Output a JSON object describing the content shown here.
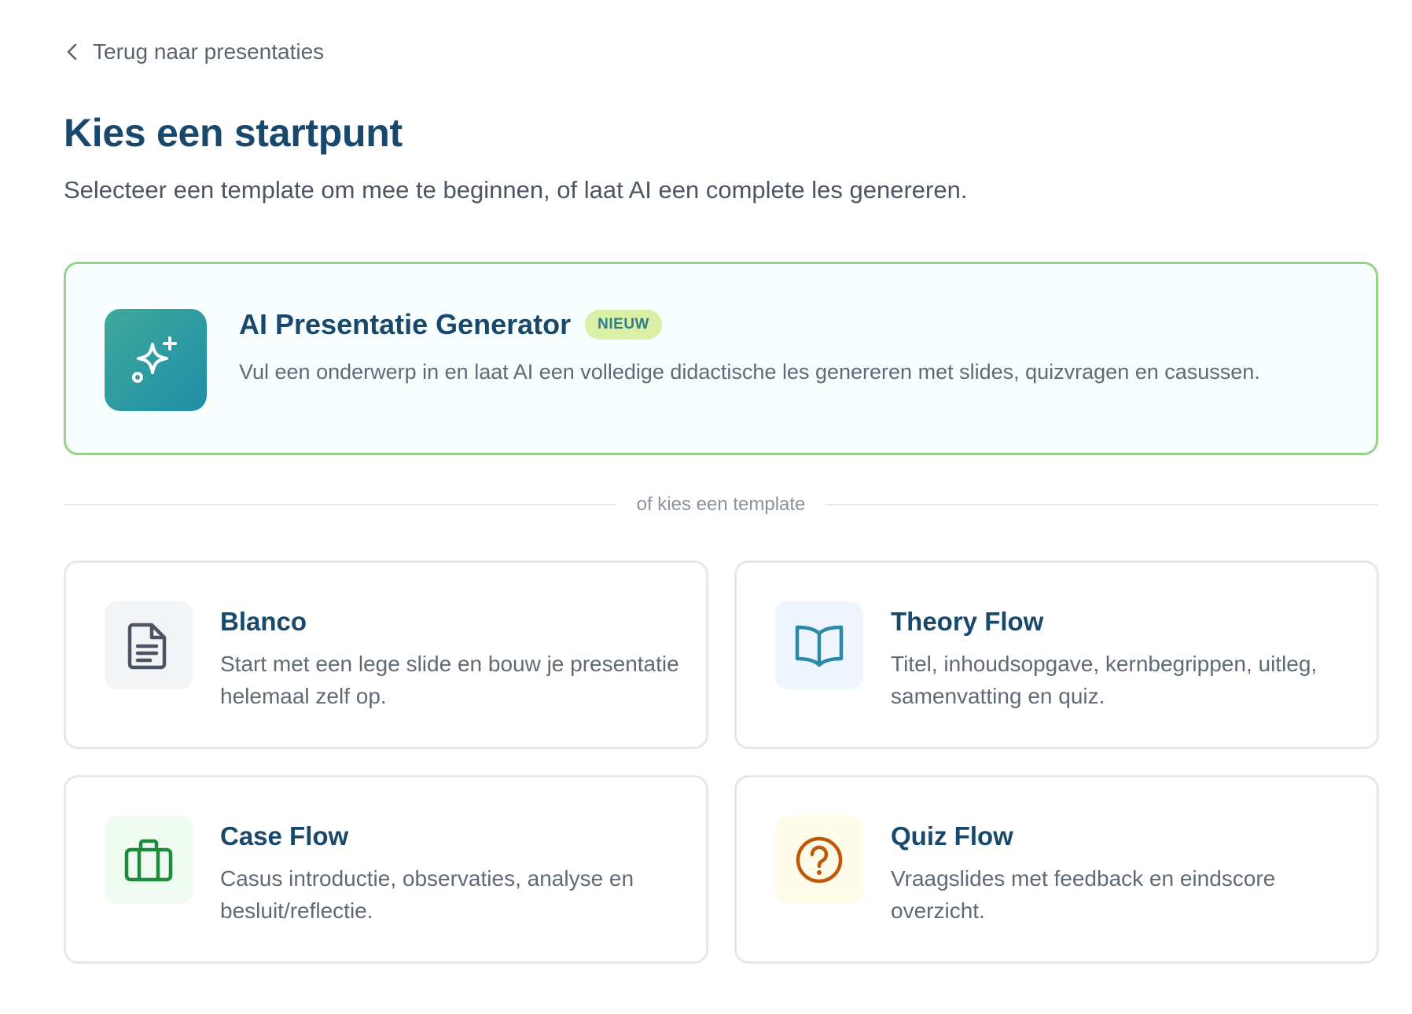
{
  "nav": {
    "back_label": "Terug naar presentaties"
  },
  "header": {
    "title": "Kies een startpunt",
    "subtitle": "Selecteer een template om mee te beginnen, of laat AI een complete les genereren."
  },
  "ai_generator": {
    "title": "AI Presentatie Generator",
    "badge": "NIEUW",
    "description": "Vul een onderwerp in en laat AI een volledige didactische les genereren met slides, quizvragen en casussen.",
    "icon": "sparkles-icon"
  },
  "divider": {
    "label": "of kies een template"
  },
  "templates": [
    {
      "title": "Blanco",
      "description": "Start met een lege slide en bouw je presentatie helemaal zelf op.",
      "icon": "document-icon",
      "icon_color": "#4b5563",
      "icon_bg": "#f3f4f6"
    },
    {
      "title": "Theory Flow",
      "description": "Titel, inhoudsopgave, kernbegrippen, uitleg, samenvatting en quiz.",
      "icon": "book-open-icon",
      "icon_color": "#2a8aa6",
      "icon_bg": "#eef5fd"
    },
    {
      "title": "Case Flow",
      "description": "Casus introductie, observaties, analyse en besluit/reflectie.",
      "icon": "briefcase-icon",
      "icon_color": "#1d8a3c",
      "icon_bg": "#effaf1"
    },
    {
      "title": "Quiz Flow",
      "description": "Vraagslides met feedback en eindscore overzicht.",
      "icon": "question-circle-icon",
      "icon_color": "#c2570c",
      "icon_bg": "#fefbe9"
    }
  ],
  "colors": {
    "heading": "#18496d",
    "body_text": "#606a76",
    "ai_border": "#93d486",
    "badge_bg": "#d9f0a6"
  }
}
